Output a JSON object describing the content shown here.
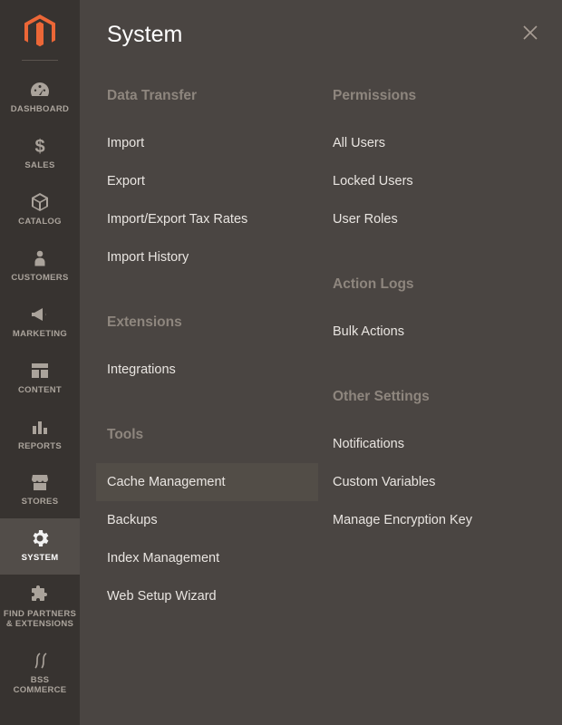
{
  "sidebar": {
    "items": [
      {
        "label": "DASHBOARD"
      },
      {
        "label": "SALES"
      },
      {
        "label": "CATALOG"
      },
      {
        "label": "CUSTOMERS"
      },
      {
        "label": "MARKETING"
      },
      {
        "label": "CONTENT"
      },
      {
        "label": "REPORTS"
      },
      {
        "label": "STORES"
      },
      {
        "label": "SYSTEM"
      },
      {
        "label": "FIND PARTNERS\n& EXTENSIONS"
      },
      {
        "label": "BSS\nCOMMERCE"
      }
    ]
  },
  "flyout": {
    "title": "System",
    "col1": [
      {
        "title": "Data Transfer",
        "items": [
          "Import",
          "Export",
          "Import/Export Tax Rates",
          "Import History"
        ]
      },
      {
        "title": "Extensions",
        "items": [
          "Integrations"
        ]
      },
      {
        "title": "Tools",
        "items": [
          "Cache Management",
          "Backups",
          "Index Management",
          "Web Setup Wizard"
        ]
      }
    ],
    "col2": [
      {
        "title": "Permissions",
        "items": [
          "All Users",
          "Locked Users",
          "User Roles"
        ]
      },
      {
        "title": "Action Logs",
        "items": [
          "Bulk Actions"
        ]
      },
      {
        "title": "Other Settings",
        "items": [
          "Notifications",
          "Custom Variables",
          "Manage Encryption Key"
        ]
      }
    ],
    "hovered": "Cache Management"
  }
}
